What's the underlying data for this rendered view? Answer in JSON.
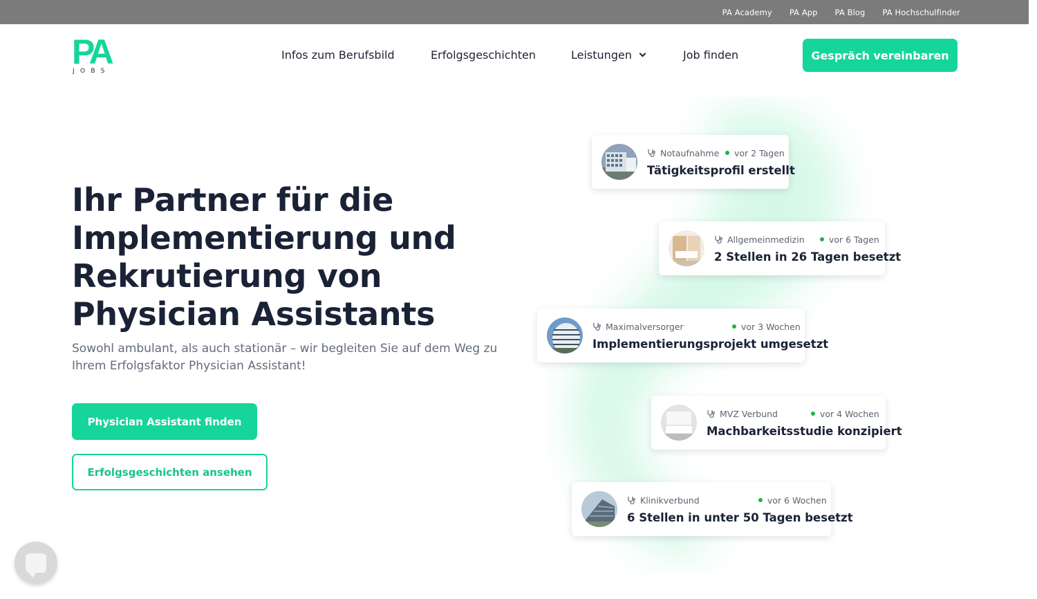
{
  "topbar": {
    "links": [
      "PA Academy",
      "PA App",
      "PA Blog",
      "PA Hochschulfinder"
    ]
  },
  "logo": {
    "main": "PA",
    "sub": "JOBS"
  },
  "nav": {
    "items": [
      {
        "label": "Infos zum Berufsbild"
      },
      {
        "label": "Erfolgsgeschichten"
      },
      {
        "label": "Leistungen",
        "has_dropdown": true
      },
      {
        "label": "Job finden"
      }
    ],
    "cta": "Gespräch vereinbaren"
  },
  "hero": {
    "title_lines": [
      "Ihr Partner für die",
      "Implementierung und",
      "Rekrutierung von",
      "Physician Assistants"
    ],
    "subtitle_lines": [
      "Sowohl ambulant, als auch stationär – wir begleiten Sie auf dem Weg zu",
      "Ihrem Erfolgsfaktor Physician Assistant!"
    ],
    "primary_button": "Physician Assistant finden",
    "secondary_button": "Erfolgsgeschichten ansehen"
  },
  "cards": [
    {
      "category": "Notaufnahme",
      "time": "vor 2 Tagen",
      "headline": "Tätigkeitsprofil erstellt",
      "photo": "building-glass"
    },
    {
      "category": "Allgemeinmedizin",
      "time": "vor 6 Tagen",
      "headline": "2 Stellen in 26 Tagen besetzt",
      "photo": "office-interior"
    },
    {
      "category": "Maximalversorger",
      "time": "vor 3 Wochen",
      "headline": "Implementierungsprojekt umgesetzt",
      "photo": "building-round"
    },
    {
      "category": "MVZ Verbund",
      "time": "vor 4 Wochen",
      "headline": "Machbarkeitsstudie konzipiert",
      "photo": "room-bed"
    },
    {
      "category": "Klinikverbund",
      "time": "vor 6 Wochen",
      "headline": "6 Stellen in unter 50 Tagen besetzt",
      "photo": "building-clinic"
    }
  ],
  "colors": {
    "brand": "#16d59a",
    "topbar": "#7b7b7b",
    "heading": "#1a2236",
    "status_dot": "#1bb34a"
  },
  "icons": {
    "card_category": "stethoscope-icon",
    "nav_dropdown": "chevron-down-icon",
    "chat": "chat-bubble-icon"
  }
}
